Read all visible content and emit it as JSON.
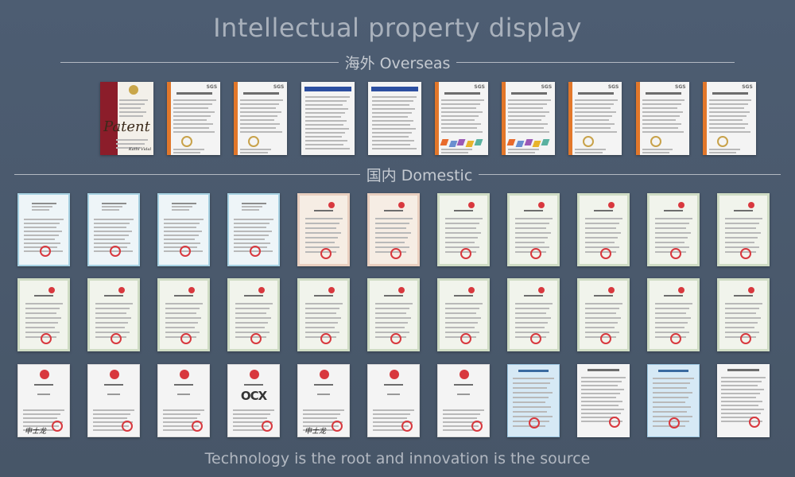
{
  "page": {
    "title": "Intellectual property display",
    "footer": "Technology is the root and innovation is the source"
  },
  "sections": {
    "overseas": {
      "label": "海外 Overseas"
    },
    "domestic": {
      "label": "国内 Domestic"
    }
  },
  "certificates": {
    "overseas": [
      {
        "kind": "patent",
        "script": "Patent",
        "sig": "Kathi Vidal"
      },
      {
        "kind": "sgs",
        "brand": "SGS"
      },
      {
        "kind": "sgs",
        "brand": "SGS"
      },
      {
        "kind": "blue"
      },
      {
        "kind": "blue"
      },
      {
        "kind": "sgs-chart",
        "brand": "SGS"
      },
      {
        "kind": "sgs-chart",
        "brand": "SGS"
      },
      {
        "kind": "sgs",
        "brand": "SGS"
      },
      {
        "kind": "sgs",
        "brand": "SGS"
      },
      {
        "kind": "sgs",
        "brand": "SGS"
      }
    ],
    "domestic_row1": [
      {
        "kind": "software"
      },
      {
        "kind": "software"
      },
      {
        "kind": "software"
      },
      {
        "kind": "software"
      },
      {
        "kind": "invention"
      },
      {
        "kind": "invention"
      },
      {
        "kind": "utility"
      },
      {
        "kind": "utility"
      },
      {
        "kind": "utility"
      },
      {
        "kind": "utility"
      },
      {
        "kind": "utility"
      }
    ],
    "domestic_row2": [
      {
        "kind": "utility"
      },
      {
        "kind": "utility"
      },
      {
        "kind": "utility"
      },
      {
        "kind": "utility"
      },
      {
        "kind": "utility"
      },
      {
        "kind": "utility"
      },
      {
        "kind": "utility"
      },
      {
        "kind": "utility"
      },
      {
        "kind": "utility"
      },
      {
        "kind": "utility"
      },
      {
        "kind": "utility"
      }
    ],
    "domestic_row3": [
      {
        "kind": "trademark",
        "sig": "申士龙"
      },
      {
        "kind": "trademark"
      },
      {
        "kind": "trademark"
      },
      {
        "kind": "trademark",
        "mark": "OCX"
      },
      {
        "kind": "trademark",
        "sig": "申士龙"
      },
      {
        "kind": "trademark"
      },
      {
        "kind": "trademark"
      },
      {
        "kind": "report-blue"
      },
      {
        "kind": "report"
      },
      {
        "kind": "report-blue"
      },
      {
        "kind": "report"
      }
    ]
  }
}
